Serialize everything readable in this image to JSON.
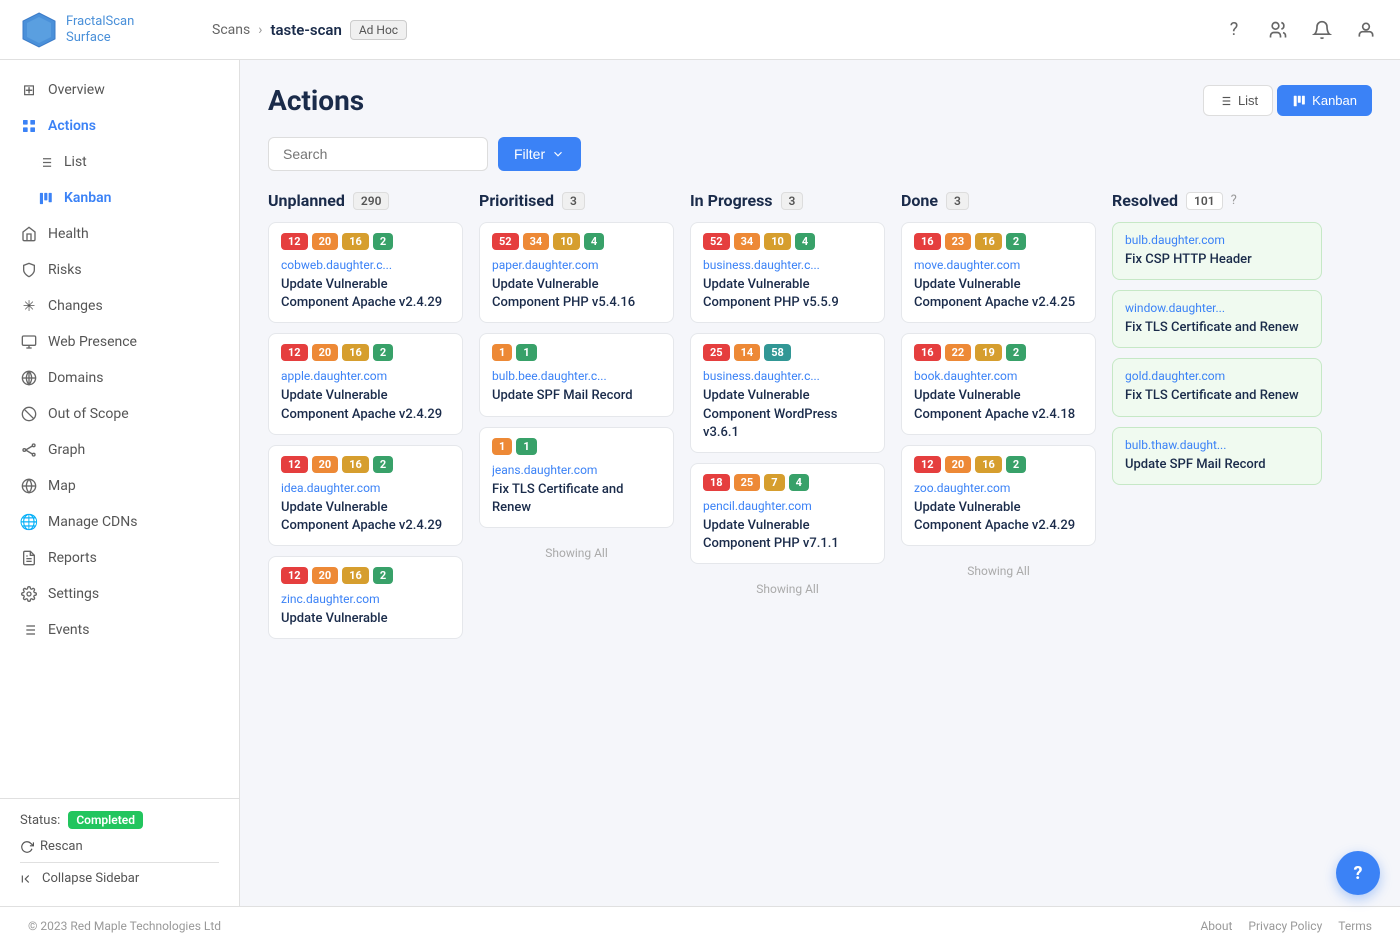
{
  "app": {
    "logo_line1": "FractalScan",
    "logo_line2": "Surface"
  },
  "breadcrumb": {
    "scans": "Scans",
    "current": "taste-scan",
    "tag": "Ad Hoc"
  },
  "topnav": {
    "icons": [
      "?",
      "👥",
      "🔔",
      "👤"
    ]
  },
  "sidebar": {
    "items": [
      {
        "id": "overview",
        "label": "Overview",
        "icon": "⊞",
        "sub": false,
        "active": false
      },
      {
        "id": "actions",
        "label": "Actions",
        "icon": "⚡",
        "sub": false,
        "active": true
      },
      {
        "id": "list",
        "label": "List",
        "icon": "☰",
        "sub": true,
        "active": false
      },
      {
        "id": "kanban",
        "label": "Kanban",
        "icon": "▦",
        "sub": true,
        "active": true
      },
      {
        "id": "health",
        "label": "Health",
        "icon": "🏠",
        "sub": false,
        "active": false
      },
      {
        "id": "risks",
        "label": "Risks",
        "icon": "🛡",
        "sub": false,
        "active": false
      },
      {
        "id": "changes",
        "label": "Changes",
        "icon": "✳",
        "sub": false,
        "active": false
      },
      {
        "id": "web-presence",
        "label": "Web Presence",
        "icon": "🖥",
        "sub": false,
        "active": false
      },
      {
        "id": "domains",
        "label": "Domains",
        "icon": "⊕",
        "sub": false,
        "active": false
      },
      {
        "id": "out-of-scope",
        "label": "Out of Scope",
        "icon": "⊕",
        "sub": false,
        "active": false
      },
      {
        "id": "graph",
        "label": "Graph",
        "icon": "✦",
        "sub": false,
        "active": false
      },
      {
        "id": "map",
        "label": "Map",
        "icon": "🌐",
        "sub": false,
        "active": false
      },
      {
        "id": "manage-cdns",
        "label": "Manage CDNs",
        "icon": "🌐",
        "sub": false,
        "active": false
      },
      {
        "id": "reports",
        "label": "Reports",
        "icon": "📋",
        "sub": false,
        "active": false
      },
      {
        "id": "settings",
        "label": "Settings",
        "icon": "⚙",
        "sub": false,
        "active": false
      },
      {
        "id": "events",
        "label": "Events",
        "icon": "☰",
        "sub": false,
        "active": false
      }
    ],
    "status_label": "Status:",
    "status_value": "Completed",
    "rescan_label": "Rescan",
    "collapse_label": "Collapse Sidebar"
  },
  "main": {
    "title": "Actions",
    "view_list": "List",
    "view_kanban": "Kanban",
    "search_placeholder": "Search",
    "filter_label": "Filter"
  },
  "kanban": {
    "columns": [
      {
        "id": "unplanned",
        "title": "Unplanned",
        "count": "290",
        "cards": [
          {
            "badges": [
              {
                "value": "12",
                "color": "red"
              },
              {
                "value": "20",
                "color": "orange"
              },
              {
                "value": "16",
                "color": "yellow"
              },
              {
                "value": "2",
                "color": "green"
              }
            ],
            "domain": "cobweb.daughter.c...",
            "title": "Update Vulnerable Component Apache v2.4.29"
          },
          {
            "badges": [
              {
                "value": "12",
                "color": "red"
              },
              {
                "value": "20",
                "color": "orange"
              },
              {
                "value": "16",
                "color": "yellow"
              },
              {
                "value": "2",
                "color": "green"
              }
            ],
            "domain": "apple.daughter.com",
            "title": "Update Vulnerable Component Apache v2.4.29"
          },
          {
            "badges": [
              {
                "value": "12",
                "color": "red"
              },
              {
                "value": "20",
                "color": "orange"
              },
              {
                "value": "16",
                "color": "yellow"
              },
              {
                "value": "2",
                "color": "green"
              }
            ],
            "domain": "idea.daughter.com",
            "title": "Update Vulnerable Component Apache v2.4.29"
          },
          {
            "badges": [
              {
                "value": "12",
                "color": "red"
              },
              {
                "value": "20",
                "color": "orange"
              },
              {
                "value": "16",
                "color": "yellow"
              },
              {
                "value": "2",
                "color": "green"
              }
            ],
            "domain": "zinc.daughter.com",
            "title": "Update Vulnerable"
          }
        ]
      },
      {
        "id": "prioritised",
        "title": "Prioritised",
        "count": "3",
        "cards": [
          {
            "badges": [
              {
                "value": "52",
                "color": "red"
              },
              {
                "value": "34",
                "color": "orange"
              },
              {
                "value": "10",
                "color": "yellow"
              },
              {
                "value": "4",
                "color": "green"
              }
            ],
            "domain": "paper.daughter.com",
            "title": "Update Vulnerable Component PHP v5.4.16"
          },
          {
            "badges": [
              {
                "value": "1",
                "color": "orange"
              },
              {
                "value": "1",
                "color": "green"
              }
            ],
            "domain": "bulb.bee.daughter.c...",
            "title": "Update SPF Mail Record"
          },
          {
            "badges": [
              {
                "value": "1",
                "color": "orange"
              },
              {
                "value": "1",
                "color": "green"
              }
            ],
            "domain": "jeans.daughter.com",
            "title": "Fix TLS Certificate and Renew"
          }
        ],
        "showing_all": "Showing All"
      },
      {
        "id": "in-progress",
        "title": "In Progress",
        "count": "3",
        "cards": [
          {
            "badges": [
              {
                "value": "52",
                "color": "red"
              },
              {
                "value": "34",
                "color": "orange"
              },
              {
                "value": "10",
                "color": "yellow"
              },
              {
                "value": "4",
                "color": "green"
              }
            ],
            "domain": "business.daughter.c...",
            "title": "Update Vulnerable Component PHP v5.5.9"
          },
          {
            "badges": [
              {
                "value": "25",
                "color": "red"
              },
              {
                "value": "14",
                "color": "orange"
              },
              {
                "value": "58",
                "color": "teal"
              }
            ],
            "domain": "business.daughter.c...",
            "title": "Update Vulnerable Component WordPress v3.6.1"
          },
          {
            "badges": [
              {
                "value": "18",
                "color": "red"
              },
              {
                "value": "25",
                "color": "orange"
              },
              {
                "value": "7",
                "color": "yellow"
              },
              {
                "value": "4",
                "color": "green"
              }
            ],
            "domain": "pencil.daughter.com",
            "title": "Update Vulnerable Component PHP v7.1.1"
          }
        ],
        "showing_all": "Showing All"
      },
      {
        "id": "done",
        "title": "Done",
        "count": "3",
        "cards": [
          {
            "badges": [
              {
                "value": "16",
                "color": "red"
              },
              {
                "value": "23",
                "color": "orange"
              },
              {
                "value": "16",
                "color": "yellow"
              },
              {
                "value": "2",
                "color": "green"
              }
            ],
            "domain": "move.daughter.com",
            "title": "Update Vulnerable Component Apache v2.4.25"
          },
          {
            "badges": [
              {
                "value": "16",
                "color": "red"
              },
              {
                "value": "22",
                "color": "orange"
              },
              {
                "value": "19",
                "color": "yellow"
              },
              {
                "value": "2",
                "color": "green"
              }
            ],
            "domain": "book.daughter.com",
            "title": "Update Vulnerable Component Apache v2.4.18"
          },
          {
            "badges": [
              {
                "value": "12",
                "color": "red"
              },
              {
                "value": "20",
                "color": "orange"
              },
              {
                "value": "16",
                "color": "yellow"
              },
              {
                "value": "2",
                "color": "green"
              }
            ],
            "domain": "zoo.daughter.com",
            "title": "Update Vulnerable Component Apache v2.4.29"
          }
        ],
        "showing_all": "Showing All"
      },
      {
        "id": "resolved",
        "title": "Resolved",
        "count": "101",
        "cards": [
          {
            "domain": "bulb.daughter.com",
            "title": "Fix CSP HTTP Header"
          },
          {
            "domain": "window.daughter...",
            "title": "Fix TLS Certificate and Renew"
          },
          {
            "domain": "gold.daughter.com",
            "title": "Fix TLS Certificate and Renew"
          },
          {
            "domain": "bulb.thaw.daught...",
            "title": "Update SPF Mail Record"
          }
        ]
      }
    ]
  },
  "footer": {
    "copyright": "© 2023 Red Maple Technologies Ltd",
    "links": [
      "About",
      "Privacy Policy",
      "Terms"
    ]
  },
  "help_fab": "?"
}
